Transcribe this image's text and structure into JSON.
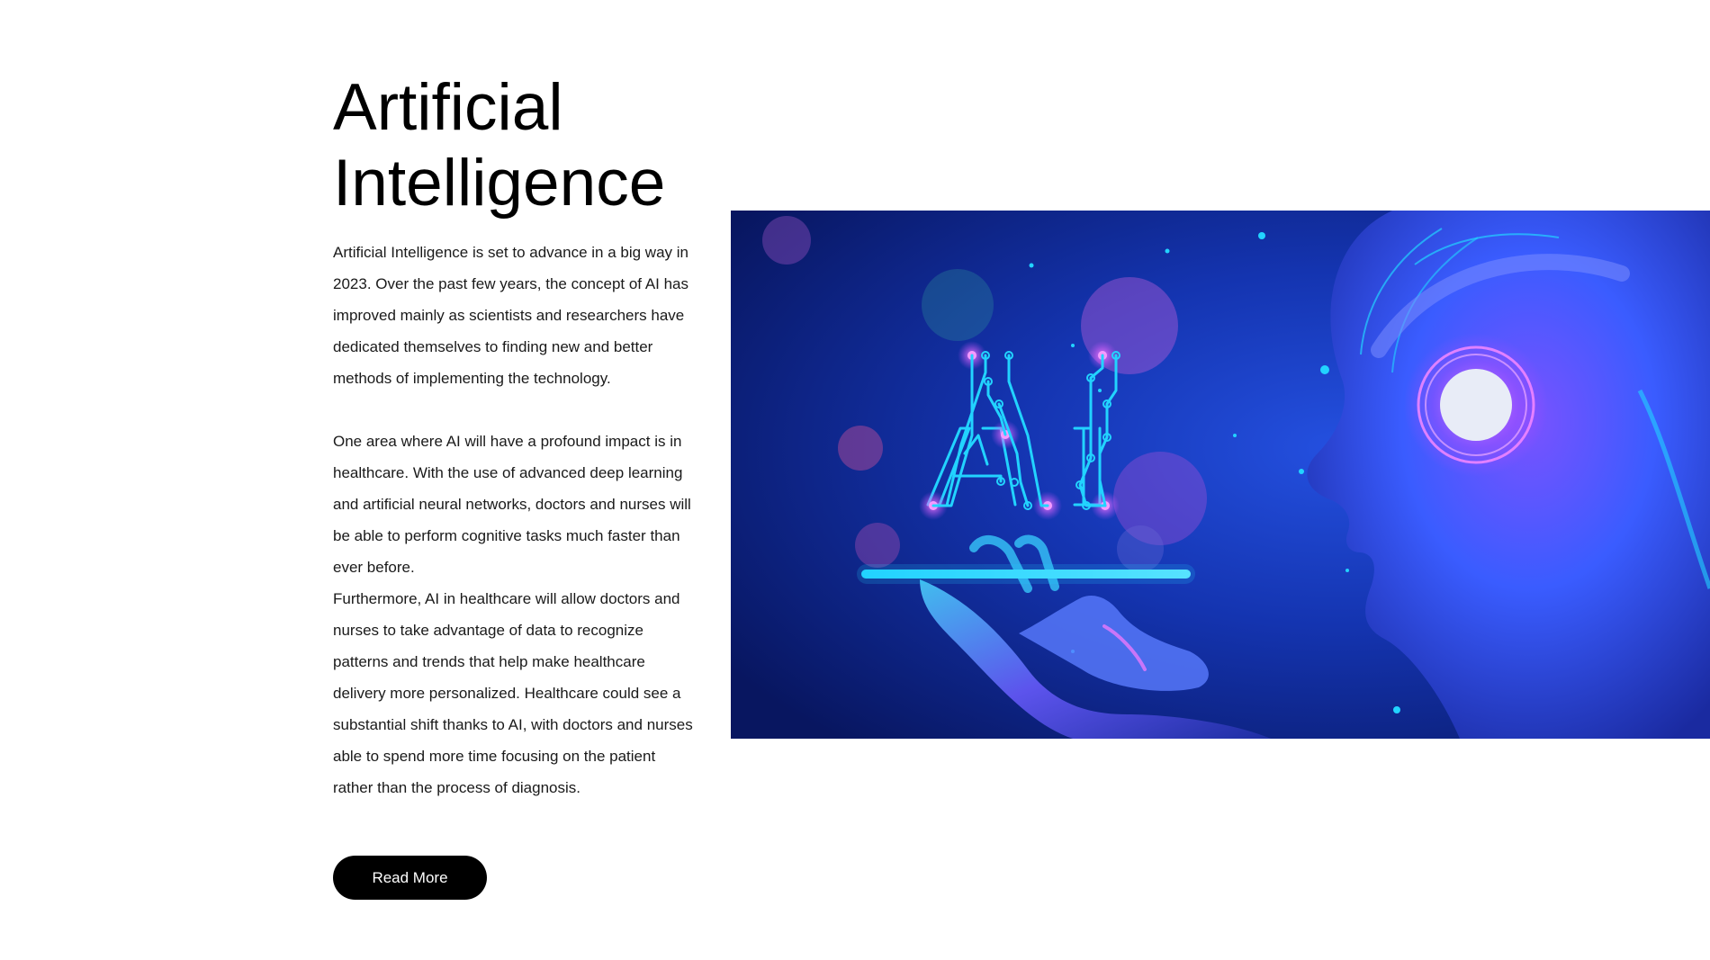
{
  "article": {
    "title_line1": "Artificial",
    "title_line2": "Intelligence",
    "paragraphs": [
      "Artificial Intelligence is set to advance in a big way in 2023. Over the past few years, the concept of AI has improved mainly as scientists and researchers have dedicated themselves to finding new and better methods of implementing the technology.",
      "One area where AI will have a profound impact is in healthcare. With the use of advanced deep learning and artificial neural networks, doctors and nurses will be able to perform cognitive tasks much faster than ever before.",
      "Furthermore, AI in healthcare will allow doctors and nurses to take advantage of data to recognize patterns and trends that help make healthcare delivery more personalized. Healthcare could see a substantial shift thanks to AI, with doctors and nurses able to spend more time focusing on the patient rather than the process of diagnosis."
    ],
    "read_more_label": "Read More"
  },
  "hero_image": {
    "logo_text": "AI",
    "colors": {
      "background_dark": "#0a1a6e",
      "background_mid": "#1438b8",
      "neon_cyan": "#22d3ff",
      "neon_purple": "#c04cff",
      "orb_white": "#e8ecf7"
    }
  }
}
